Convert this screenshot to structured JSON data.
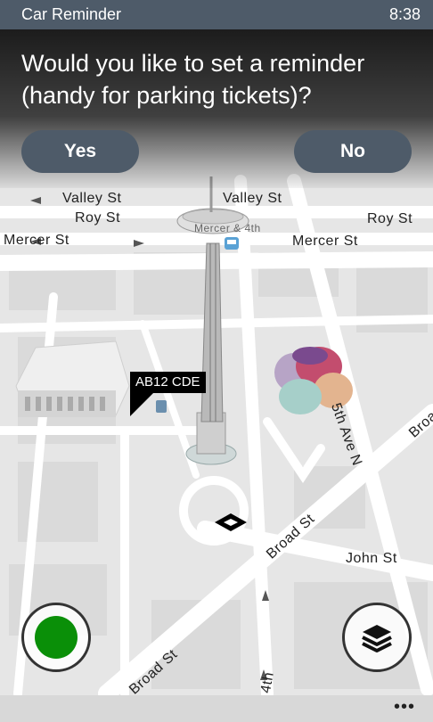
{
  "status_bar": {
    "app_title": "Car Reminder",
    "time": "8:38"
  },
  "dialog": {
    "prompt": "Would you like to set a reminder\n(handy for parking tickets)?",
    "yes_label": "Yes",
    "no_label": "No"
  },
  "map": {
    "streets": {
      "valley_left": "Valley St",
      "valley_right": "Valley St",
      "roy_left": "Roy St",
      "roy_right": "Roy St",
      "mercer_left": "Mercer St",
      "mercer_right": "Mercer St",
      "mercer_4th": "Mercer & 4th",
      "fifth_ave": "5th Ave N",
      "broad_mid": "Broad St",
      "broad_low": "Broad St",
      "broad_edge": "Broad",
      "john": "John St",
      "fourth": "4th"
    },
    "car_marker": {
      "plate": "AB12 CDE"
    }
  },
  "controls": {
    "record_icon": "green-circle-icon",
    "layers_icon": "layers-icon"
  },
  "app_bar": {
    "more_label": "•••"
  }
}
